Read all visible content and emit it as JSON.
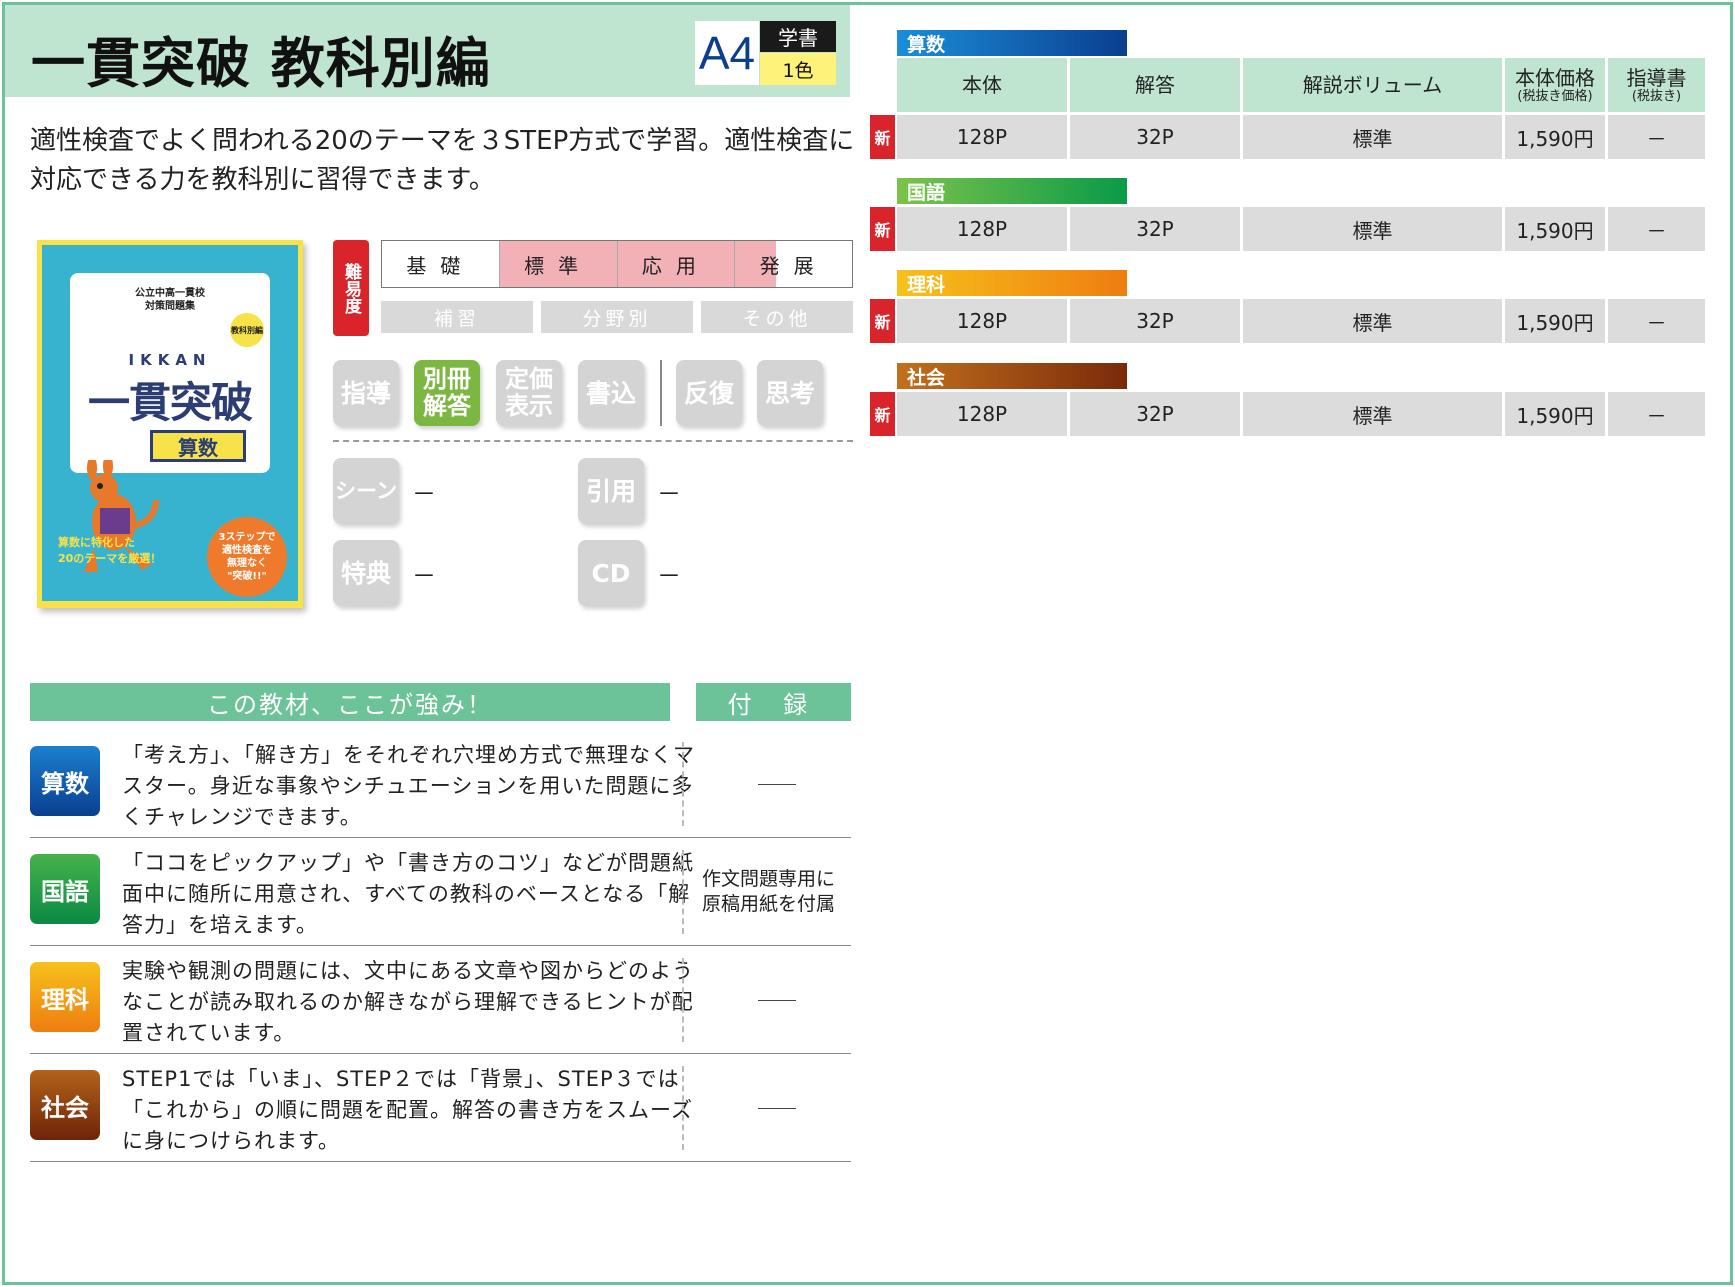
{
  "header": {
    "title": "一貫突破 教科別編",
    "size": "A4",
    "grade": "学書",
    "color_count": "1色"
  },
  "description": "適性検査でよく問われる20のテーマを３STEP方式で学習。適性検査に対応できる力を教科別に習得できます。",
  "cover": {
    "series_line1": "公立中高一貫校",
    "series_line2": "対策問題集",
    "tag": "教科別編",
    "romaji": "IKKAN",
    "brand": "一貫突破",
    "subject": "算数",
    "catch_line1": "算数に特化した",
    "catch_line2": "20のテーマを厳選！",
    "badge_line1": "3ステップで",
    "badge_line2": "適性検査を",
    "badge_line3": "無理なく",
    "badge_line4": "\"突破!!\"",
    "colors": {
      "frame": "#f7e24a",
      "background": "#38b3cf",
      "title": "#2c3d73"
    }
  },
  "difficulty": {
    "label": "難易度",
    "levels": [
      {
        "name": "基礎",
        "level": "none"
      },
      {
        "name": "標準",
        "level": "full"
      },
      {
        "name": "応用",
        "level": "full"
      },
      {
        "name": "発展",
        "level": "partial"
      }
    ],
    "categories": [
      "補習",
      "分野別",
      "その他"
    ]
  },
  "features": {
    "icons": [
      {
        "label": "指導",
        "active": false
      },
      {
        "label": "別冊解答",
        "active": true
      },
      {
        "label": "定価表示",
        "active": false
      },
      {
        "label": "書込",
        "active": false
      },
      {
        "label": "反復",
        "active": false
      },
      {
        "label": "思考",
        "active": false
      }
    ],
    "scene": {
      "label": "シーン",
      "value": "－"
    },
    "quote": {
      "label": "引用",
      "value": "－"
    },
    "bonus": {
      "label": "特典",
      "value": "－"
    },
    "cd": {
      "label": "CD",
      "value": "－"
    }
  },
  "strengths": {
    "heading": "この教材、ここが強み！",
    "bonus_heading": "付 録",
    "rows": [
      {
        "subject": "算数",
        "color": "#0a4ea3",
        "text": "「考え方」、「解き方」をそれぞれ穴埋め方式で無理なくマスター。身近な事象やシチュエーションを用いた問題に多くチャレンジできます。",
        "bonus": ""
      },
      {
        "subject": "国語",
        "color": "#17994a",
        "text": "「ココをピックアップ」や「書き方のコツ」などが問題紙面中に随所に用意され、すべての教科のベースとなる「解答力」を培えます。",
        "bonus": "作文問題専用に原稿用紙を付属"
      },
      {
        "subject": "理科",
        "color": "#f29a12",
        "text": "実験や観測の問題には、文中にある文章や図からどのようなことが読み取れるのか解きながら理解できるヒントが配置されています。",
        "bonus": ""
      },
      {
        "subject": "社会",
        "color": "#8a3a10",
        "text": "STEP1では「いま」、STEP２では「背景」、STEP３では「これから」の順に問題を配置。解答の書き方をスムーズに身につけられます。",
        "bonus": ""
      }
    ]
  },
  "price_table": {
    "headers": {
      "body": "本体",
      "answer": "解答",
      "volume": "解説ボリューム",
      "price": "本体価格",
      "price_note": "(税抜き価格)",
      "guide": "指導書",
      "guide_note": "(税抜き)"
    },
    "new_label": "新",
    "rows": [
      {
        "subject": "算数",
        "color_from": "#1b8ed8",
        "color_to": "#0a3f8f",
        "body": "128P",
        "answer": "32P",
        "volume": "標準",
        "price": "1,590円",
        "guide": "－"
      },
      {
        "subject": "国語",
        "color_from": "#7cc34a",
        "color_to": "#0a9a48",
        "body": "128P",
        "answer": "32P",
        "volume": "標準",
        "price": "1,590円",
        "guide": "－"
      },
      {
        "subject": "理科",
        "color_from": "#f7c21b",
        "color_to": "#ee7d10",
        "body": "128P",
        "answer": "32P",
        "volume": "標準",
        "price": "1,590円",
        "guide": "－"
      },
      {
        "subject": "社会",
        "color_from": "#c3701d",
        "color_to": "#7a2a0a",
        "body": "128P",
        "answer": "32P",
        "volume": "標準",
        "price": "1,590円",
        "guide": "－"
      }
    ]
  }
}
